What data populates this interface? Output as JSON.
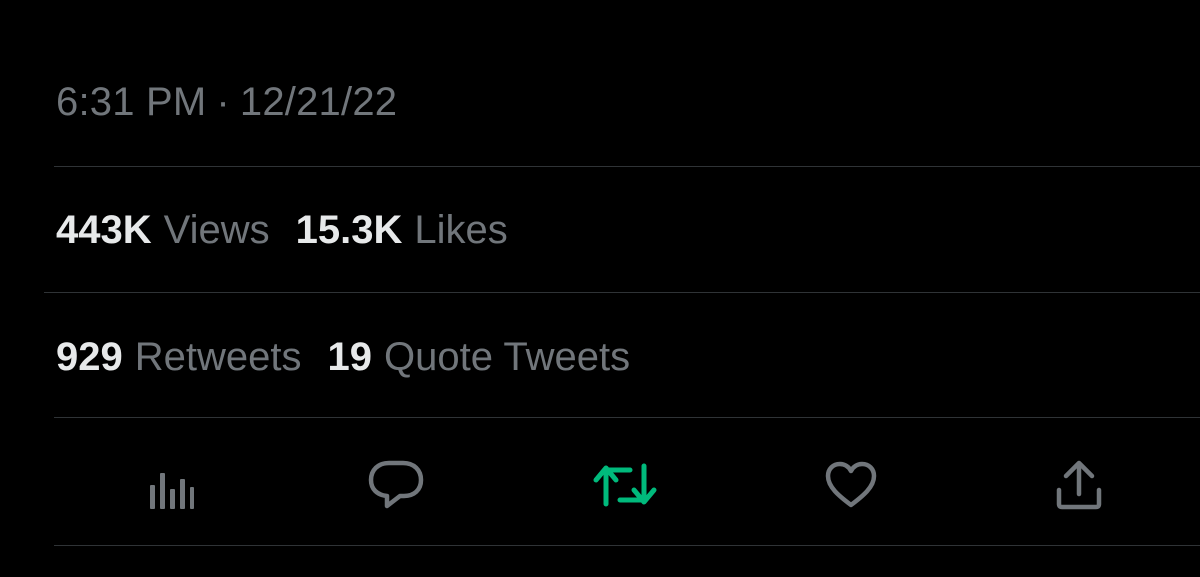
{
  "tweet_meta": {
    "time": "6:31 PM",
    "separator": "·",
    "date": "12/21/22"
  },
  "stats": {
    "views": {
      "count": "443K",
      "label": "Views"
    },
    "likes": {
      "count": "15.3K",
      "label": "Likes"
    },
    "retweets": {
      "count": "929",
      "label": "Retweets"
    },
    "quote_tweets": {
      "count": "19",
      "label": "Quote Tweets"
    }
  },
  "actions": [
    {
      "name": "views-analytics",
      "icon": "bar-chart-icon",
      "active": false
    },
    {
      "name": "reply",
      "icon": "speech-bubble-icon",
      "active": false
    },
    {
      "name": "retweet",
      "icon": "retweet-icon",
      "active": true
    },
    {
      "name": "like",
      "icon": "heart-icon",
      "active": false
    },
    {
      "name": "share",
      "icon": "share-icon",
      "active": false
    }
  ],
  "colors": {
    "background": "#000000",
    "muted_text": "#71767b",
    "primary_text": "#e7e9ea",
    "divider": "#2f3336",
    "retweet_active": "#00ba7c"
  }
}
